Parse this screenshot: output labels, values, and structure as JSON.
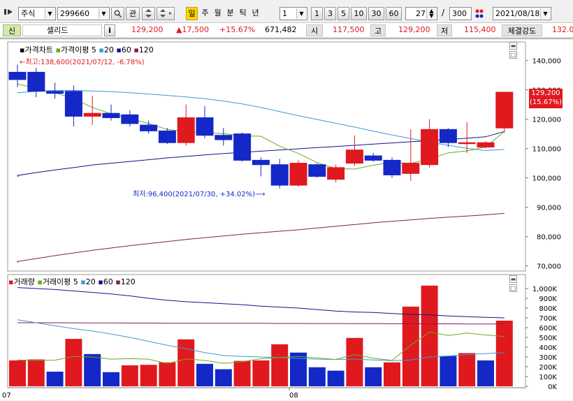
{
  "toolbar": {
    "market_select": "주식",
    "code_input": "299660",
    "btn_related": "관",
    "period_active": "일",
    "periods": [
      "주",
      "월",
      "분",
      "틱",
      "년"
    ],
    "interval_select": "1",
    "quick_nums": [
      "1",
      "3",
      "5",
      "10",
      "30",
      "60"
    ],
    "count_value": "27",
    "count_sep": "/",
    "count_total": "300",
    "date_select": "2021/08/18"
  },
  "info": {
    "market_badge": "신",
    "name": "셀리드",
    "info_btn": "i",
    "price": "129,200",
    "change": "▲17,500",
    "change_pct": "+15.67%",
    "volume": "671,482",
    "open_label": "시",
    "open": "117,500",
    "high_label": "고",
    "high": "129,200",
    "low_label": "저",
    "low": "115,400",
    "strength_label": "체결강도",
    "strength": "132.0"
  },
  "colors": {
    "up": "#e0191f",
    "down": "#1428c8",
    "ma5": "#6aaa1e",
    "ma20": "#3c9ad2",
    "ma60": "#14148c",
    "ma120": "#821e50"
  },
  "price_legend": {
    "title": "가격차트",
    "ma_title": "가격이평",
    "periods": [
      "5",
      "20",
      "60",
      "120"
    ]
  },
  "volume_legend": {
    "title": "거래량",
    "ma_title": "거래이평",
    "periods": [
      "5",
      "20",
      "60",
      "120"
    ]
  },
  "annotations": {
    "high_note": "←최고:138,600(2021/07/12, -6.78%)",
    "low_note": "최저:96,400(2021/07/30, +34.02%)⟶",
    "last_price": "129,200",
    "last_pct": "(15.67%)"
  },
  "chart_data": [
    {
      "type": "candlestick",
      "title": "가격차트",
      "x_labels": [
        "07",
        "08"
      ],
      "y_ticks": [
        "140,000",
        "130,000",
        "120,000",
        "110,000",
        "100,000",
        "90,000",
        "80,000",
        "70,000"
      ],
      "ylim": [
        68000,
        143000
      ],
      "candles": [
        {
          "o": 136000,
          "h": 138600,
          "l": 131000,
          "c": 133500
        },
        {
          "o": 136000,
          "h": 137500,
          "l": 127500,
          "c": 129500
        },
        {
          "o": 129500,
          "h": 132500,
          "l": 127000,
          "c": 128800
        },
        {
          "o": 129500,
          "h": 131500,
          "l": 117500,
          "c": 121000
        },
        {
          "o": 121000,
          "h": 128000,
          "l": 118000,
          "c": 122000
        },
        {
          "o": 122000,
          "h": 125000,
          "l": 119500,
          "c": 120500
        },
        {
          "o": 121500,
          "h": 123000,
          "l": 117500,
          "c": 118500
        },
        {
          "o": 118000,
          "h": 119500,
          "l": 115000,
          "c": 116000
        },
        {
          "o": 116000,
          "h": 117000,
          "l": 111500,
          "c": 112000
        },
        {
          "o": 112000,
          "h": 125000,
          "l": 111000,
          "c": 120500
        },
        {
          "o": 120500,
          "h": 124500,
          "l": 113500,
          "c": 114500
        },
        {
          "o": 114500,
          "h": 117000,
          "l": 111000,
          "c": 113000
        },
        {
          "o": 115000,
          "h": 115500,
          "l": 105500,
          "c": 106000
        },
        {
          "o": 106000,
          "h": 107000,
          "l": 100500,
          "c": 104500
        },
        {
          "o": 104500,
          "h": 106500,
          "l": 96400,
          "c": 97500
        },
        {
          "o": 97500,
          "h": 106000,
          "l": 97000,
          "c": 105000
        },
        {
          "o": 104500,
          "h": 105000,
          "l": 100000,
          "c": 100500
        },
        {
          "o": 99500,
          "h": 104500,
          "l": 98500,
          "c": 103500
        },
        {
          "o": 105000,
          "h": 114500,
          "l": 104000,
          "c": 109500
        },
        {
          "o": 107500,
          "h": 108500,
          "l": 105500,
          "c": 106000
        },
        {
          "o": 106000,
          "h": 107000,
          "l": 100000,
          "c": 101000
        },
        {
          "o": 101500,
          "h": 116500,
          "l": 99000,
          "c": 105000
        },
        {
          "o": 104500,
          "h": 120000,
          "l": 103500,
          "c": 116500
        },
        {
          "o": 116500,
          "h": 117000,
          "l": 110500,
          "c": 112000
        },
        {
          "o": 112000,
          "h": 119000,
          "l": 108500,
          "c": 112000
        },
        {
          "o": 110500,
          "h": 112500,
          "l": 110000,
          "c": 112000
        },
        {
          "o": 117000,
          "h": 129200,
          "l": 115400,
          "c": 129200
        }
      ],
      "ma5": [
        132000,
        130500,
        129000,
        127000,
        124000,
        121800,
        120300,
        118500,
        116500,
        115800,
        115400,
        115100,
        114300,
        114200,
        110800,
        108300,
        105200,
        103200,
        103000,
        104300,
        105300,
        104900,
        106500,
        108500,
        109200,
        110500,
        115800
      ],
      "ma20": [
        129000,
        129500,
        129800,
        129800,
        129600,
        129400,
        129000,
        128600,
        128100,
        127600,
        127000,
        126200,
        125200,
        124000,
        122600,
        121200,
        119900,
        118600,
        117300,
        115900,
        114600,
        113400,
        112100,
        111100,
        110100,
        109300,
        109700
      ],
      "ma60": [
        100800,
        101800,
        102700,
        103500,
        104400,
        105000,
        105600,
        106200,
        106800,
        107300,
        107800,
        108300,
        108700,
        109100,
        109500,
        109900,
        110300,
        110700,
        111100,
        111500,
        111900,
        112300,
        112700,
        113100,
        113500,
        114000,
        115800
      ],
      "ma120": [
        71500,
        72500,
        73500,
        74400,
        75300,
        76100,
        76900,
        77600,
        78300,
        79000,
        79600,
        80200,
        80800,
        81300,
        81800,
        82300,
        82900,
        83500,
        84100,
        84700,
        85200,
        85700,
        86200,
        86600,
        87000,
        87400,
        87900
      ]
    },
    {
      "type": "bar",
      "title": "거래량",
      "y_ticks": [
        "1,000K",
        "900K",
        "800K",
        "700K",
        "600K",
        "500K",
        "400K",
        "300K",
        "200K",
        "100K",
        "0K"
      ],
      "ylim": [
        0,
        1000000
      ],
      "values": [
        265000,
        275000,
        150000,
        485000,
        330000,
        145000,
        215000,
        220000,
        245000,
        480000,
        230000,
        175000,
        260000,
        265000,
        430000,
        345000,
        195000,
        160000,
        495000,
        195000,
        245000,
        815000,
        1030000,
        310000,
        340000,
        265000,
        671482
      ],
      "up": [
        true,
        true,
        false,
        true,
        false,
        false,
        true,
        true,
        true,
        true,
        false,
        false,
        true,
        true,
        true,
        false,
        false,
        false,
        true,
        false,
        true,
        true,
        true,
        false,
        true,
        false,
        true
      ],
      "ma5": [
        270000,
        265000,
        268000,
        305000,
        300000,
        278000,
        283000,
        278000,
        232000,
        280000,
        265000,
        235000,
        252000,
        282000,
        295000,
        305000,
        290000,
        275000,
        325000,
        288000,
        265000,
        420000,
        555000,
        520000,
        545000,
        525000,
        510000
      ],
      "ma20": [
        680000,
        650000,
        620000,
        590000,
        565000,
        535000,
        500000,
        460000,
        420000,
        385000,
        345000,
        315000,
        305000,
        300000,
        295000,
        285000,
        278000,
        275000,
        278000,
        270000,
        262000,
        270000,
        300000,
        310000,
        325000,
        335000,
        345000
      ],
      "ma60": [
        1010000,
        1000000,
        990000,
        975000,
        960000,
        945000,
        925000,
        900000,
        880000,
        865000,
        855000,
        845000,
        835000,
        820000,
        810000,
        800000,
        785000,
        770000,
        760000,
        755000,
        745000,
        735000,
        730000,
        720000,
        713000,
        705000,
        700000
      ],
      "ma120": [
        650000,
        650000,
        650000,
        649000,
        648000,
        648000,
        647000,
        647000,
        646000,
        646000,
        645000,
        645000,
        644000,
        644000,
        643000,
        643000,
        642000,
        642000,
        641000,
        641000,
        640000,
        640000,
        639000,
        639000,
        638000,
        638000,
        637000
      ]
    }
  ]
}
